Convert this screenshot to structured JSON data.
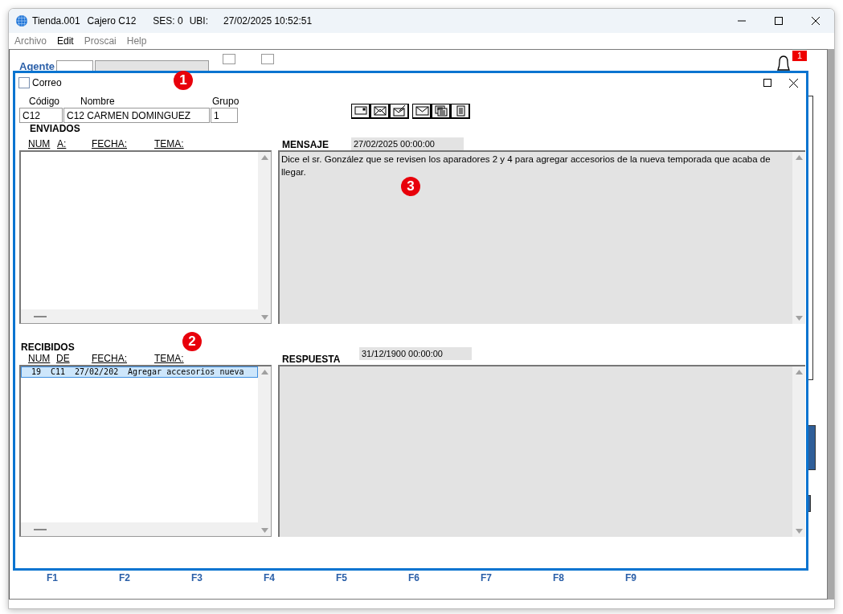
{
  "window": {
    "title_parts": [
      "Tienda.001",
      "Cajero C12",
      "SES: 0",
      "UBI:",
      "27/02/2025 10:52:51"
    ]
  },
  "menu": [
    {
      "label": "Archivo",
      "disabled": true
    },
    {
      "label": "Edit",
      "disabled": false
    },
    {
      "label": "Proscai",
      "disabled": true
    },
    {
      "label": "Help",
      "disabled": true
    }
  ],
  "background": {
    "agent_label": "Agente",
    "checkboxes": [
      {
        "checked": false
      },
      {
        "checked": false
      }
    ],
    "notification_count": "1",
    "function_keys": [
      "F1",
      "F2",
      "F3",
      "F4",
      "F5",
      "F6",
      "F7",
      "F8",
      "F9"
    ]
  },
  "dialog": {
    "title": "Correo",
    "fields": [
      {
        "label": "Código",
        "value": "C12"
      },
      {
        "label": "Nombre",
        "value": "C12 CARMEN DOMINGUEZ"
      },
      {
        "label": "Grupo",
        "value": "1"
      }
    ],
    "sent": {
      "title": "ENVIADOS",
      "columns": [
        "NUM",
        "A:",
        "FECHA:",
        "TEMA:"
      ]
    },
    "received": {
      "title": "RECIBIDOS",
      "columns": [
        "NUM",
        "DE",
        "FECHA:",
        "TEMA:"
      ],
      "rows": [
        {
          "num": "19",
          "from": "C11",
          "date": "27/02/202",
          "subject": "Agregar accesorios nueva",
          "selected": true
        }
      ]
    },
    "message": {
      "label": "MENSAJE",
      "date": "27/02/2025 00:00:00",
      "text": "Dice el sr. González que se revisen los aparadores 2 y 4 para agregar accesorios de la nueva temporada que acaba de llegar."
    },
    "reply": {
      "label": "RESPUESTA",
      "date": "31/12/1900 00:00:00"
    }
  },
  "callouts": [
    "1",
    "2",
    "3"
  ]
}
